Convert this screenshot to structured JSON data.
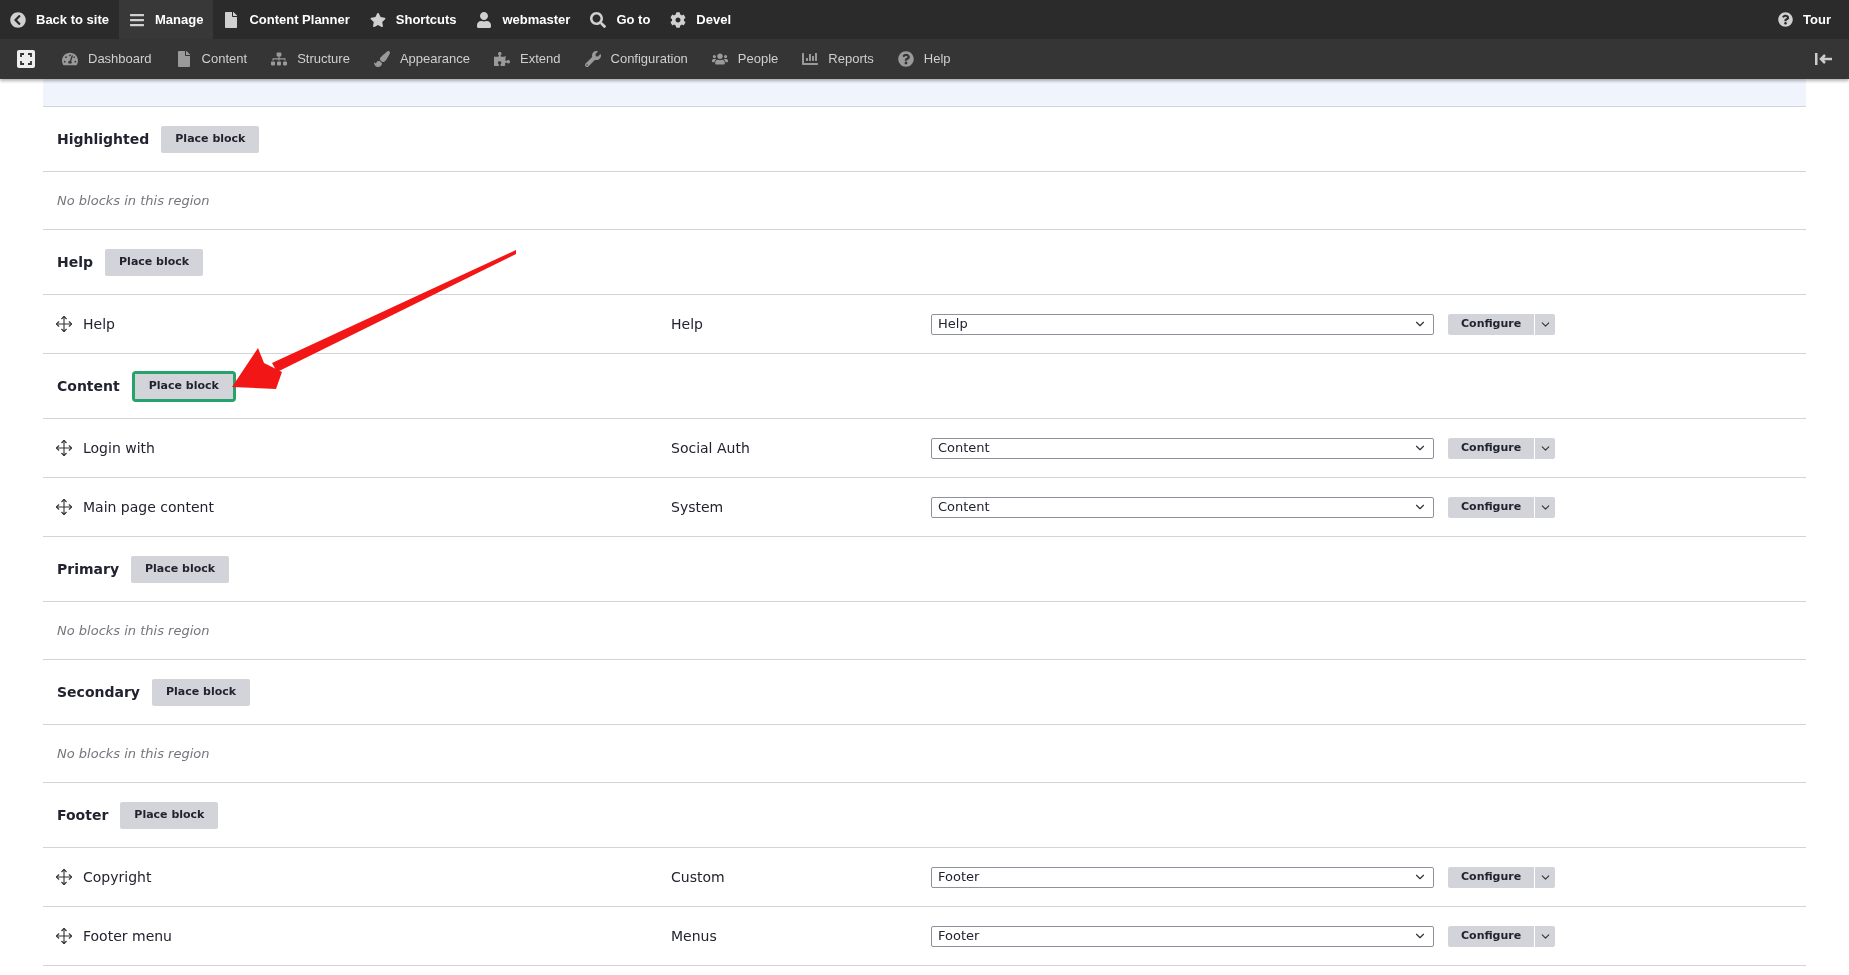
{
  "toolbar": {
    "items": [
      {
        "label": "Back to site",
        "selected": false
      },
      {
        "label": "Manage",
        "selected": true
      },
      {
        "label": "Content Planner",
        "selected": false
      },
      {
        "label": "Shortcuts",
        "selected": false
      },
      {
        "label": "webmaster",
        "selected": false
      },
      {
        "label": "Go to",
        "selected": false
      },
      {
        "label": "Devel",
        "selected": false
      }
    ],
    "tour": "Tour"
  },
  "menu": {
    "items": [
      {
        "label": "Dashboard"
      },
      {
        "label": "Content"
      },
      {
        "label": "Structure"
      },
      {
        "label": "Appearance"
      },
      {
        "label": "Extend"
      },
      {
        "label": "Configuration"
      },
      {
        "label": "People"
      },
      {
        "label": "Reports"
      },
      {
        "label": "Help"
      }
    ]
  },
  "rows": [
    {
      "kind": "region",
      "title": "Highlighted",
      "button": "Place block",
      "highlighted": false
    },
    {
      "kind": "empty",
      "text": "No blocks in this region"
    },
    {
      "kind": "region",
      "title": "Help",
      "button": "Place block",
      "highlighted": false
    },
    {
      "kind": "block",
      "title": "Help",
      "category": "Help",
      "region": "Help",
      "configure": "Configure"
    },
    {
      "kind": "region",
      "title": "Content",
      "button": "Place block",
      "highlighted": true
    },
    {
      "kind": "block",
      "title": "Login with",
      "category": "Social Auth",
      "region": "Content",
      "configure": "Configure"
    },
    {
      "kind": "block",
      "title": "Main page content",
      "category": "System",
      "region": "Content",
      "configure": "Configure"
    },
    {
      "kind": "region",
      "title": "Primary",
      "button": "Place block",
      "highlighted": false
    },
    {
      "kind": "empty",
      "text": "No blocks in this region"
    },
    {
      "kind": "region",
      "title": "Secondary",
      "button": "Place block",
      "highlighted": false
    },
    {
      "kind": "empty",
      "text": "No blocks in this region"
    },
    {
      "kind": "region",
      "title": "Footer",
      "button": "Place block",
      "highlighted": false
    },
    {
      "kind": "block",
      "title": "Copyright",
      "category": "Custom",
      "region": "Footer",
      "configure": "Configure"
    },
    {
      "kind": "block",
      "title": "Footer menu",
      "category": "Menus",
      "region": "Footer",
      "configure": "Configure"
    }
  ]
}
